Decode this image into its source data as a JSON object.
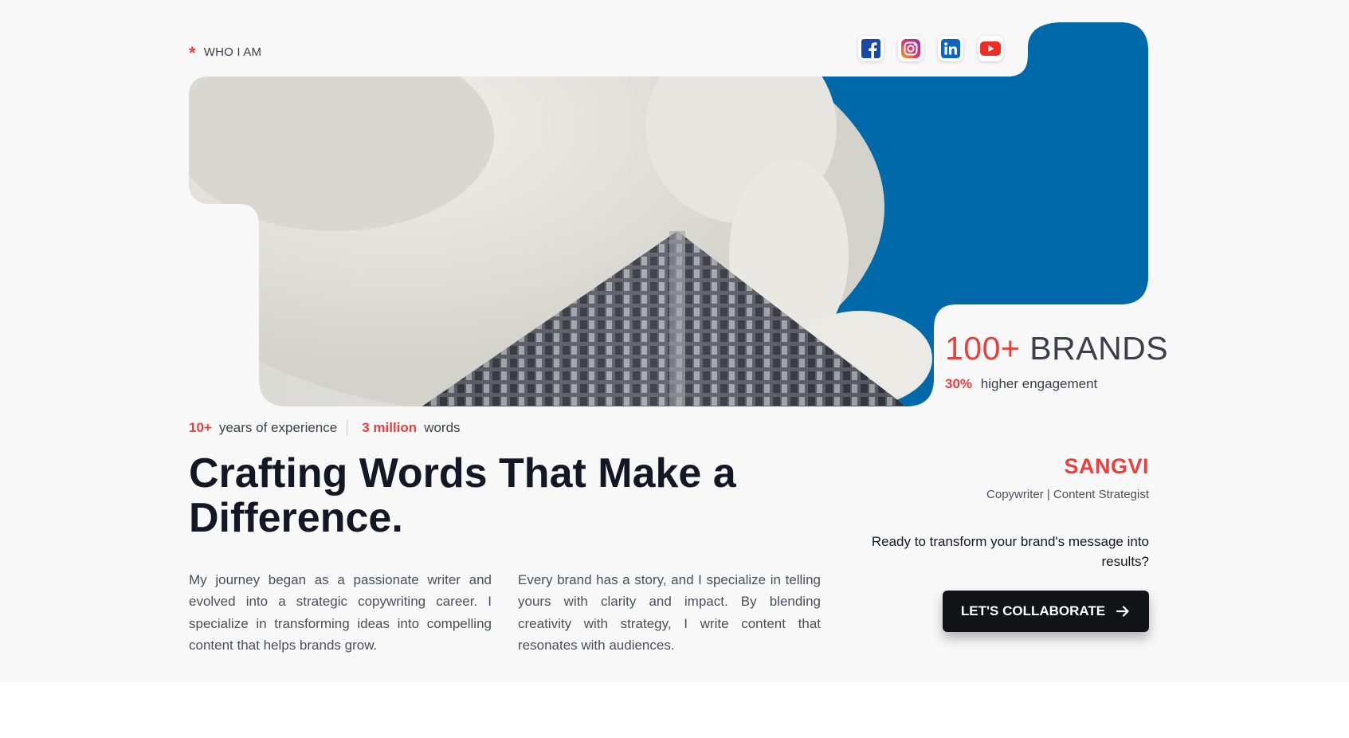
{
  "eyebrow": {
    "marker": "*",
    "label": "WHO I AM"
  },
  "socials": [
    {
      "icon": "facebook-icon",
      "color": "#1877f2"
    },
    {
      "icon": "instagram-icon",
      "color": "#d6249f"
    },
    {
      "icon": "linkedin-icon",
      "color": "#0a66c2"
    },
    {
      "icon": "youtube-icon",
      "color": "#ff0000"
    }
  ],
  "stats": {
    "brands_number": "100+",
    "brands_label": "BRANDS",
    "engagement_number": "30%",
    "engagement_label": "higher engagement",
    "experience_number": "10+",
    "experience_label": "years of experience",
    "words_number": "3 million",
    "words_label": "words"
  },
  "headline": "Crafting Words That Make a Difference.",
  "paragraphs": [
    "My journey began as a passionate writer and evolved into a strategic copywriting career. I specialize in transforming ideas into compelling content that helps brands grow.",
    "Every brand has a story, and I specialize in telling yours with clarity and impact. By blending creativity with strategy, I write content that resonates with audiences."
  ],
  "profile": {
    "name": "SANGVI",
    "role": "Copywriter | Content Strategist"
  },
  "cta": {
    "text": "Ready to transform your brand's message into results?",
    "button_label": "LET'S COLLABORATE"
  },
  "colors": {
    "accent": "#e8403d",
    "blue_panel": "#0069a9",
    "dark": "#111317",
    "page_bg": "#f8f8f8"
  }
}
